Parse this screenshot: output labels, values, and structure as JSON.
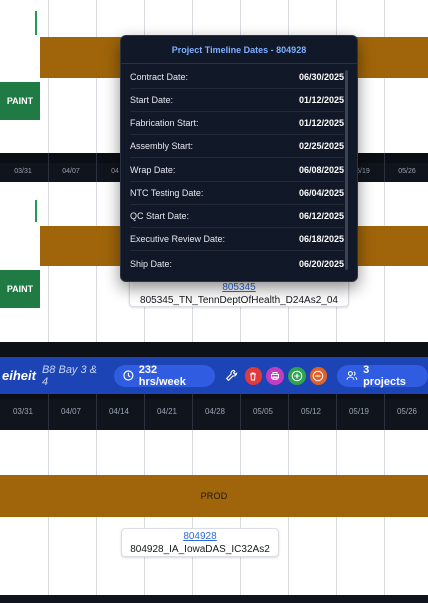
{
  "top_section": {
    "paint_label": "PAINT",
    "dates": [
      "03/31",
      "04/07",
      "04",
      "05/19",
      "05/26"
    ]
  },
  "middle_section": {
    "paint_label": "PAINT",
    "project_link": "805345",
    "project_name": "805345_TN_TennDeptOfHealth_D24As2_04"
  },
  "tooltip": {
    "title": "Project Timeline Dates - 804928",
    "rows": [
      {
        "label": "Contract Date:",
        "value": "06/30/2025"
      },
      {
        "label": "Start Date:",
        "value": "01/12/2025"
      },
      {
        "label": "Fabrication Start:",
        "value": "01/12/2025"
      },
      {
        "label": "Assembly Start:",
        "value": "02/25/2025"
      },
      {
        "label": "Wrap Date:",
        "value": "06/08/2025"
      },
      {
        "label": "NTC Testing Date:",
        "value": "06/04/2025"
      },
      {
        "label": "QC Start Date:",
        "value": "06/12/2025"
      },
      {
        "label": "Executive Review Date:",
        "value": "06/18/2025"
      },
      {
        "label": "Ship Date:",
        "value": "06/20/2025"
      }
    ]
  },
  "toolbar": {
    "brand": "eiheit",
    "bay": "B8 Bay 3 & 4",
    "hours": "232 hrs/week",
    "projects": "3 projects",
    "icons": [
      "wrench-icon",
      "trash-icon",
      "printer-icon",
      "plus-circle-icon",
      "minus-circle-icon",
      "users-icon"
    ],
    "colors": {
      "toolbar": "#1c44b5",
      "trash": "#e23a3a",
      "printer": "#c43cc0",
      "plus": "#2fa34f",
      "minus": "#e0612a"
    }
  },
  "bottom_section": {
    "dates": [
      "03/31",
      "04/07",
      "04/14",
      "04/21",
      "04/28",
      "05/05",
      "05/12",
      "05/19",
      "05/26"
    ],
    "bar_label": "PROD",
    "project_link": "804928",
    "project_name": "804928_IA_IowaDAS_IC32As2"
  },
  "colors": {
    "bar": "#a0650a",
    "paint": "#1f7a43",
    "link": "#2f6bdf"
  }
}
